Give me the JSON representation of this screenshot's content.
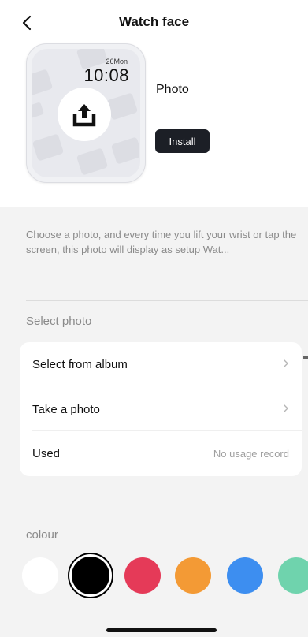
{
  "header": {
    "title": "Watch face"
  },
  "preview": {
    "date": "26Mon",
    "time": "10:08"
  },
  "photo": {
    "label": "Photo",
    "install_label": "Install"
  },
  "description": "Choose a photo, and every time you lift your wrist or tap the screen, this photo will display as setup Wat...",
  "select_photo": {
    "title": "Select photo",
    "items": [
      {
        "label": "Select from album"
      },
      {
        "label": "Take a photo"
      },
      {
        "label": "Used",
        "value": "No usage record"
      }
    ]
  },
  "colour": {
    "title": "colour",
    "swatches": [
      {
        "name": "white",
        "hex": "#ffffff",
        "selected": false
      },
      {
        "name": "black",
        "hex": "#000000",
        "selected": true
      },
      {
        "name": "red",
        "hex": "#e53a58",
        "selected": false
      },
      {
        "name": "orange",
        "hex": "#f39a35",
        "selected": false
      },
      {
        "name": "blue",
        "hex": "#3d8ef0",
        "selected": false
      },
      {
        "name": "green",
        "hex": "#6fd3ad",
        "selected": false
      }
    ]
  }
}
